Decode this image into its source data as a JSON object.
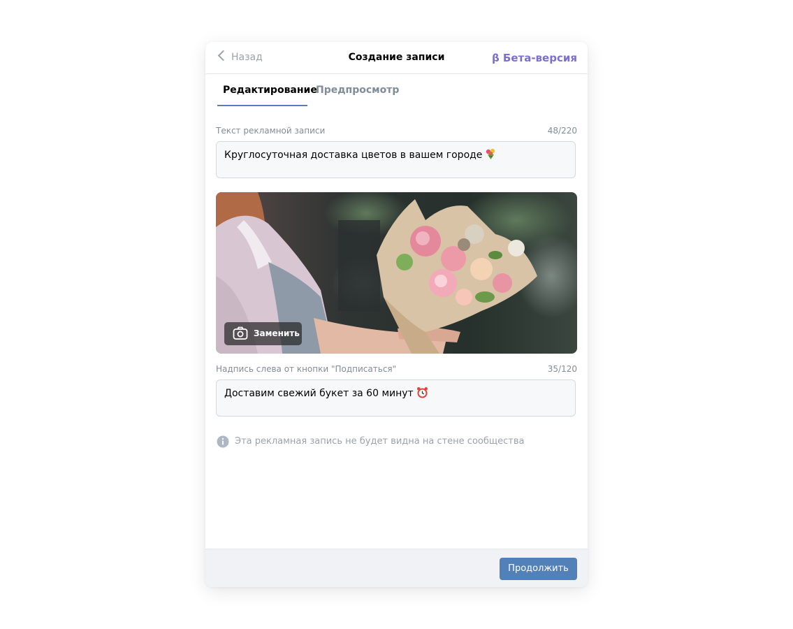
{
  "header": {
    "back_label": "Назад",
    "title": "Создание записи",
    "beta_label": "β Бета-версия"
  },
  "tabs": [
    {
      "label": "Редактирование",
      "active": true
    },
    {
      "label": "Предпросмотр",
      "active": false
    }
  ],
  "ad_text": {
    "label": "Текст рекламной записи",
    "counter": "48/220",
    "value": "Круглосуточная доставка цветов в вашем городе",
    "emoji": "bouquet-emoji"
  },
  "image": {
    "replace_label": "Заменить",
    "alt_icon": "camera-icon"
  },
  "caption_text": {
    "label": "Надпись слева от кнопки \"Подписаться\"",
    "counter": "35/120",
    "value": "Доставим свежий букет за 60 минут",
    "emoji": "alarm-clock-emoji"
  },
  "info": {
    "text": "Эта рекламная запись не будет видна на стене сообщества",
    "icon": "info-icon"
  },
  "footer": {
    "continue_label": "Продолжить"
  },
  "colors": {
    "accent": "#5181b8",
    "beta": "#7b6fd0",
    "muted": "#818c99",
    "footer_bg": "#f0f2f5"
  }
}
